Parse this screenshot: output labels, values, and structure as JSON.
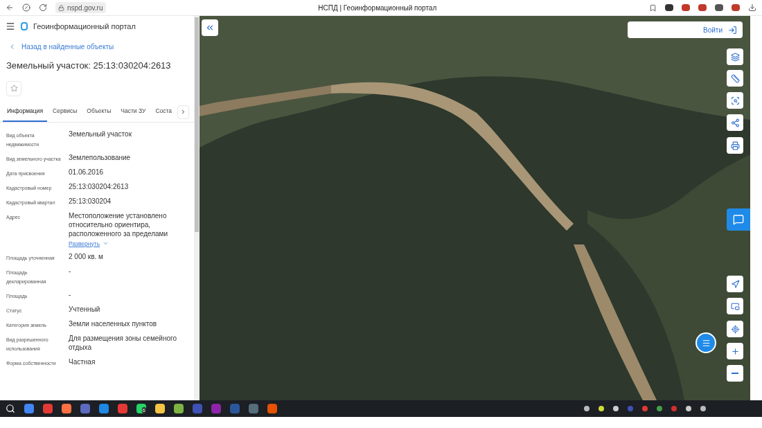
{
  "browser": {
    "url": "nspd.gov.ru",
    "title": "НСПД | Геоинформационный портал"
  },
  "header": {
    "title": "Геоинформационный портал"
  },
  "back_link": "Назад в найденные объекты",
  "object_title": "Земельный участок: 25:13:030204:2613",
  "tabs": [
    {
      "label": "Информация",
      "selected": true
    },
    {
      "label": "Сервисы",
      "selected": false
    },
    {
      "label": "Объекты",
      "selected": false
    },
    {
      "label": "Части ЗУ",
      "selected": false
    },
    {
      "label": "Соста",
      "selected": false
    }
  ],
  "fields": [
    {
      "label": "Вид объекта недвижимости",
      "value": "Земельный участок"
    },
    {
      "label": "Вид земельного участка",
      "value": "Землепользование"
    },
    {
      "label": "Дата присвоения",
      "value": "01.06.2016"
    },
    {
      "label": "Кадастровый номер",
      "value": "25:13:030204:2613"
    },
    {
      "label": "Кадастровый квартал",
      "value": "25:13:030204"
    },
    {
      "label": "Адрес",
      "value": "Местоположение установлено относительно ориентира, расположенного за пределами",
      "expand_link": "Развернуть"
    },
    {
      "label": "Площадь уточненная",
      "value": "2 000 кв. м"
    },
    {
      "label": "Площадь декларированная",
      "value": "-"
    },
    {
      "label": "Площадь",
      "value": "-"
    },
    {
      "label": "Статус",
      "value": "Учтенный"
    },
    {
      "label": "Категория земель",
      "value": "Земли населенных пунктов"
    },
    {
      "label": "Вид разрешенного использования",
      "value": "Для размещения зоны семейного отдыха"
    },
    {
      "label": "Форма собственности",
      "value": "Частная"
    }
  ],
  "map": {
    "login_button": "Войти"
  },
  "taskbar": {
    "badge": "6"
  }
}
